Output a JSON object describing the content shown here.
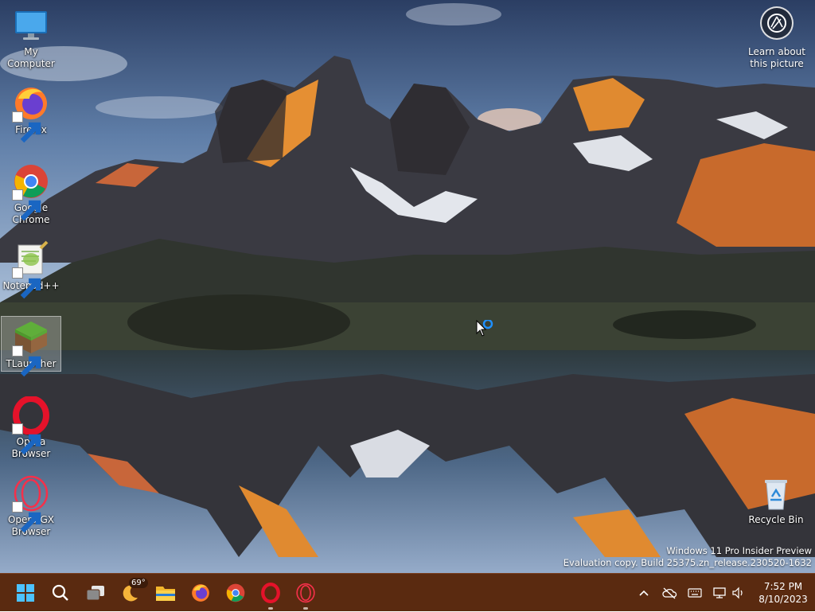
{
  "desktop": {
    "icons": [
      {
        "label": "My Computer"
      },
      {
        "label": "Firefox"
      },
      {
        "label": "Google Chrome"
      },
      {
        "label": "Notepad++"
      },
      {
        "label": "TLauncher"
      },
      {
        "label": "Opera Browser"
      },
      {
        "label": "Opera GX Browser"
      },
      {
        "label": "Recycle Bin"
      }
    ],
    "learn_picture": {
      "label": "Learn about this picture"
    },
    "watermark": {
      "line1": "Windows 11 Pro Insider Preview",
      "line2": "Evaluation copy. Build 25375.zn_release.230520-1632"
    }
  },
  "taskbar": {
    "weather_temp": "69°",
    "apps": [
      "start",
      "search",
      "task-view",
      "weather",
      "file-explorer",
      "firefox",
      "chrome",
      "opera",
      "opera-gx"
    ],
    "tray": [
      "show-hidden-icons",
      "onedrive-offline",
      "keyboard",
      "network",
      "volume"
    ],
    "clock": {
      "time": "7:52 PM",
      "date": "8/10/2023"
    }
  },
  "colors": {
    "taskbar": "#5a2a10",
    "accent": "#1e90ff"
  }
}
